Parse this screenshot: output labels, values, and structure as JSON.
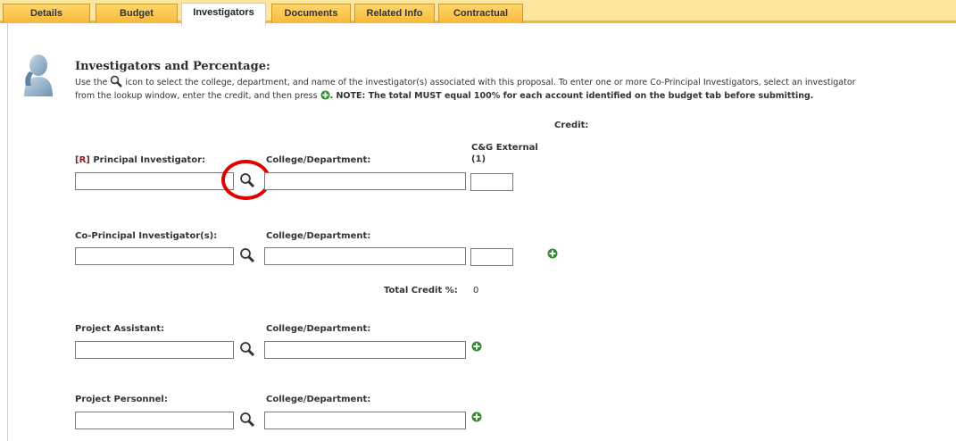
{
  "tabs": [
    {
      "label": "Details"
    },
    {
      "label": "Budget"
    },
    {
      "label": "Investigators"
    },
    {
      "label": "Documents"
    },
    {
      "label": "Related Info"
    },
    {
      "label": "Contractual"
    }
  ],
  "section": {
    "title": "Investigators and Percentage:",
    "instr_1": "Use the",
    "instr_2": "icon to select the college, department, and name of the investigator(s) associated with this proposal. To enter one or more Co-Principal Investigators, select an investigator",
    "instr_3": "from the lookup window, enter the credit, and then press",
    "instr_note": ". NOTE: The total MUST equal 100% for each account identified on the budget tab before submitting."
  },
  "credit_header": {
    "credit_label": "Credit:",
    "external_label_1": "C&G External",
    "external_label_2": "(1)"
  },
  "principal": {
    "required_marker": "[R]",
    "label": "Principal Investigator:",
    "dept_label": "College/Department:",
    "name_value": "",
    "dept_value": "",
    "credit_value": ""
  },
  "co_principal": {
    "label": "Co-Principal Investigator(s):",
    "dept_label": "College/Department:",
    "name_value": "",
    "dept_value": "",
    "credit_value": ""
  },
  "total_credit": {
    "label": "Total Credit %:",
    "value": "0"
  },
  "project_assistant": {
    "label": "Project Assistant:",
    "dept_label": "College/Department:",
    "name_value": "",
    "dept_value": ""
  },
  "project_personnel": {
    "label": "Project Personnel:",
    "dept_label": "College/Department:",
    "name_value": "",
    "dept_value": ""
  },
  "icons": {
    "lookup": "magnifier-icon",
    "add": "green-plus-icon",
    "person": "person-silhouette-icon"
  },
  "colors": {
    "tab_bar": "#fde7a0",
    "tab_accent": "#f7b733",
    "highlight_circle": "#e00000",
    "add_green": "#2e8b2e"
  }
}
